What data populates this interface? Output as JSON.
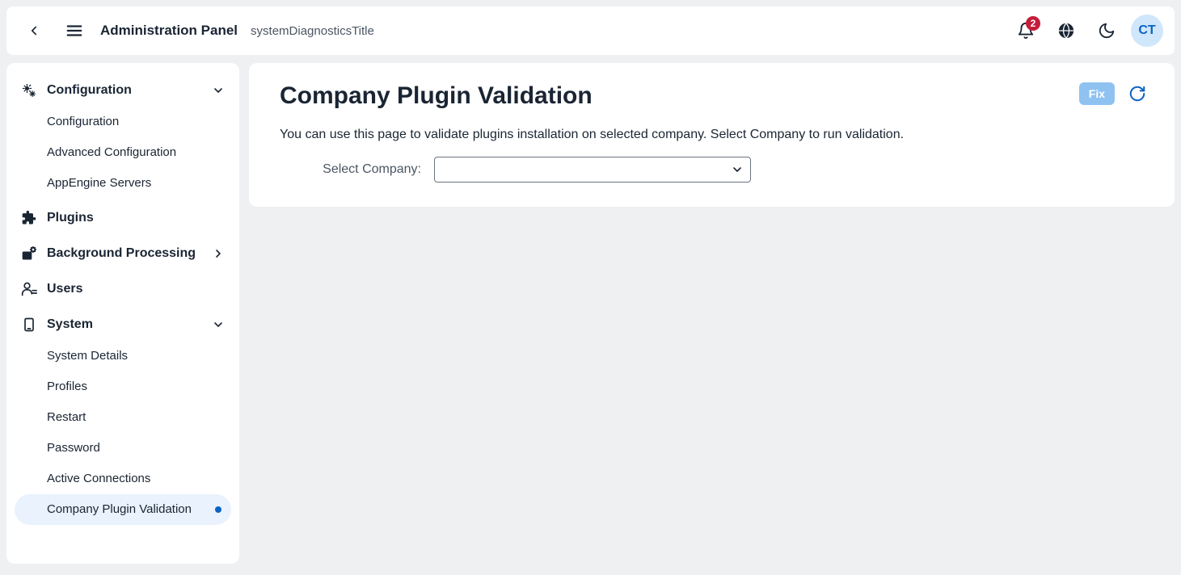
{
  "header": {
    "title": "Administration Panel",
    "subtitle": "systemDiagnosticsTitle",
    "notifications_count": "2",
    "avatar_initials": "CT"
  },
  "sidebar": {
    "configuration": {
      "label": "Configuration",
      "items": [
        "Configuration",
        "Advanced Configuration",
        "AppEngine Servers"
      ]
    },
    "plugins_label": "Plugins",
    "background_label": "Background Processing",
    "users_label": "Users",
    "system": {
      "label": "System",
      "items": [
        "System Details",
        "Profiles",
        "Restart",
        "Password",
        "Active Connections",
        "Company Plugin Validation"
      ]
    }
  },
  "main": {
    "title": "Company Plugin Validation",
    "description": "You can use this page to validate plugins installation on selected company. Select Company to run validation.",
    "select_label": "Select Company:",
    "select_value": "",
    "fix_label": "Fix"
  }
}
